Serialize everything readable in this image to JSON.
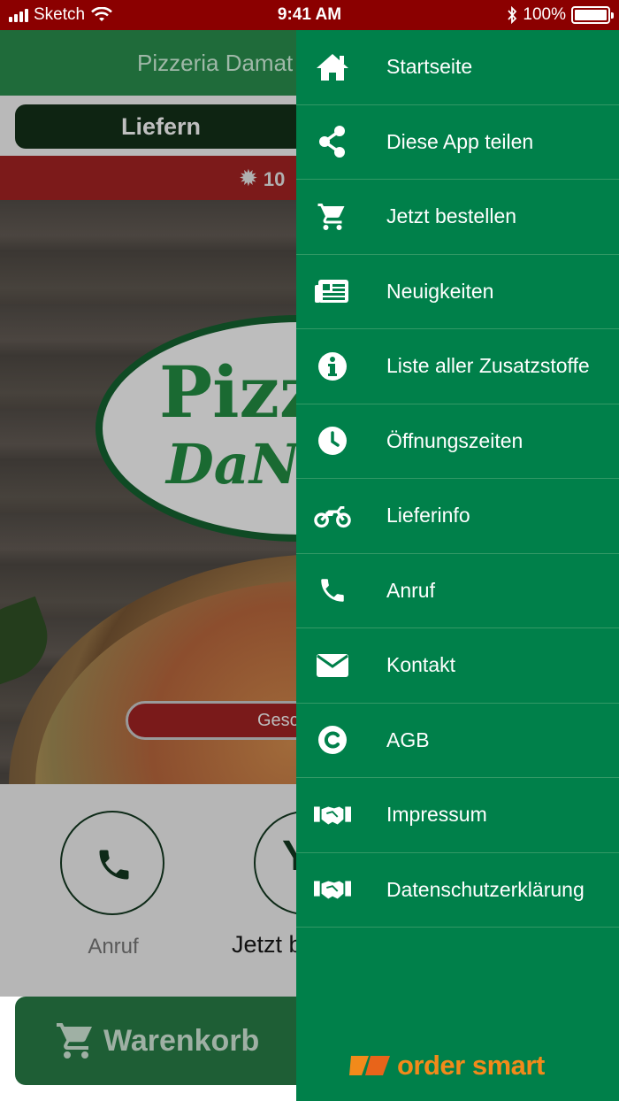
{
  "status_bar": {
    "carrier": "Sketch",
    "time": "9:41 AM",
    "battery": "100%"
  },
  "app": {
    "header_title": "Pizzeria Damat",
    "tab_delivery": "Liefern",
    "promo_text": "10",
    "logo_line1": "Pizz",
    "logo_line2": "DaN",
    "status_pill": "Gesc",
    "action_call_label": "Anruf",
    "action_order_label": "Jetzt b",
    "cart_label": "Warenkorb"
  },
  "drawer": {
    "items": [
      {
        "label": "Startseite",
        "icon": "home-icon"
      },
      {
        "label": "Diese App teilen",
        "icon": "share-icon"
      },
      {
        "label": "Jetzt bestellen",
        "icon": "cart-icon"
      },
      {
        "label": "Neuigkeiten",
        "icon": "newspaper-icon"
      },
      {
        "label": "Liste aller Zusatzstoffe",
        "icon": "info-icon"
      },
      {
        "label": "Öffnungszeiten",
        "icon": "clock-icon"
      },
      {
        "label": "Lieferinfo",
        "icon": "motorcycle-icon"
      },
      {
        "label": "Anruf",
        "icon": "phone-icon"
      },
      {
        "label": "Kontakt",
        "icon": "envelope-icon"
      },
      {
        "label": "AGB",
        "icon": "copyright-icon"
      },
      {
        "label": "Impressum",
        "icon": "handshake-icon"
      },
      {
        "label": "Datenschutzerklärung",
        "icon": "handshake-icon"
      }
    ],
    "brand": "order smart"
  },
  "colors": {
    "drawer_bg": "#00804a",
    "status_bar_bg": "#8b0000",
    "brand_orange": "#f28a1a"
  }
}
